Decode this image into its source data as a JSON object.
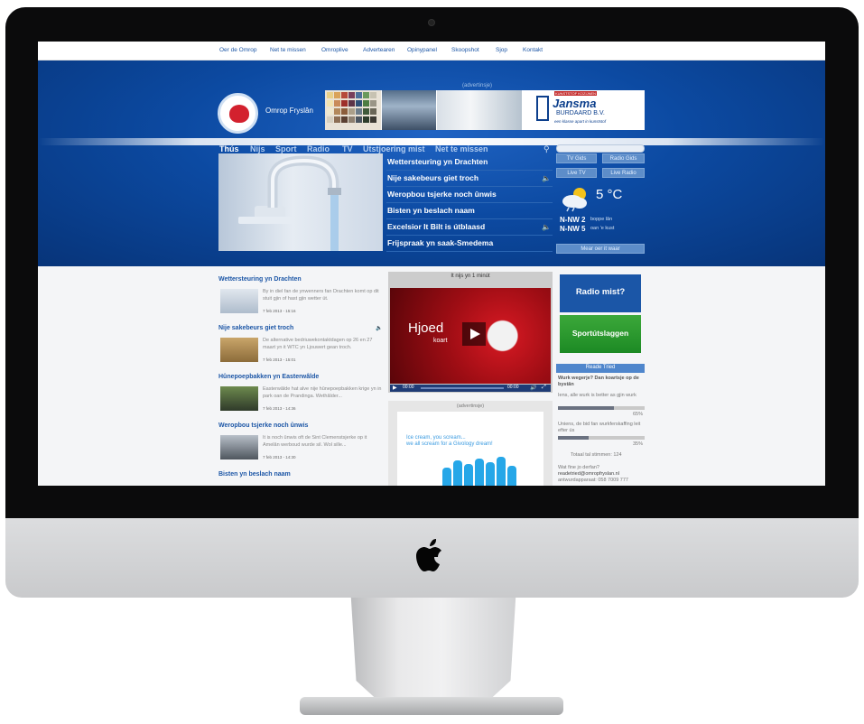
{
  "top_nav": [
    "Oer de Omrop",
    "Net te missen",
    "Omroplive",
    "Advertearen",
    "Opinypanel",
    "Skoopshot",
    "Sjop",
    "Kontakt"
  ],
  "brand": {
    "name": "Omrop Fryslân",
    "ad_label": "(advertinsje)"
  },
  "banner_ad": {
    "company": "Jansma",
    "company_sub": "BURDAARD B.V.",
    "tagline": "een klasse apart in kunststof",
    "badge": "KUNSTSTOF KOZIJNEN"
  },
  "main_nav": [
    "Thús",
    "Nijs",
    "Sport",
    "Radio",
    "TV",
    "Utstjoering mist",
    "Net te missen"
  ],
  "headlines": [
    {
      "title": "Wettersteuring yn Drachten",
      "audio": false
    },
    {
      "title": "Nije sakebeurs giet troch",
      "audio": true
    },
    {
      "title": "Weropbou tsjerke noch ûnwis",
      "audio": false
    },
    {
      "title": "Bisten yn beslach naam",
      "audio": false
    },
    {
      "title": "Excelsior It Bilt is útblaasd",
      "audio": true
    },
    {
      "title": "Frijspraak yn saak-Smedema",
      "audio": false
    }
  ],
  "side_buttons": {
    "tv_gids": "TV Gids",
    "radio_gids": "Radio Gids",
    "live_tv": "Live TV",
    "live_radio": "Live Radio"
  },
  "weather": {
    "temp": "5 °C",
    "wind1": "N-NW 2",
    "wind1_desc": "boppe lân",
    "wind2": "N-NW 5",
    "wind2_desc": "oan 'e kust",
    "more": "Mear oer it waar"
  },
  "news": [
    {
      "title": "Wettersteuring yn Drachten",
      "text": "By in diel fan de ynwenners fan Drachten komt op dit stuit gjin of hast gjin wetter út.",
      "date": "7 feb 2013 - 15:16",
      "audio": false
    },
    {
      "title": "Nije sakebeurs giet troch",
      "text": "De alternative bedriuwekontaktdagen op 26 en 27 maart yn it WTC yn Ljouwert gean troch.",
      "date": "7 feb 2013 - 15:01",
      "audio": true
    },
    {
      "title": "Hûnepoepbakken yn Easterwâlde",
      "text": "Easterwâlde hat alve nije hûnepoepbakken krige yn in park oan de Prandinga. Wethâlder...",
      "date": "7 feb 2013 - 14:36",
      "audio": false
    },
    {
      "title": "Weropbou tsjerke noch ûnwis",
      "text": "It is noch ûnwis oft de Sint Clemenstsjerke op it Amelân werboud wurde sil. Wol sille...",
      "date": "7 feb 2013 - 14:30",
      "audio": false
    },
    {
      "title": "Bisten yn beslach naam",
      "text": "",
      "date": "",
      "audio": false
    }
  ],
  "video": {
    "title": "It nijs yn 1 minút",
    "overlay": "Hjoed",
    "overlay_sub": "koart",
    "time_current": "00:00",
    "time_total": "00:00"
  },
  "ad2": {
    "label": "(advertinsje)",
    "line1": "Ice cream, you scream...",
    "line2": "we all scream for a Givology dream!"
  },
  "promo": {
    "radio_mist": "Radio mist?",
    "sport": "Sportútslaggen"
  },
  "poll": {
    "header": "Reade Tried",
    "question": "Wurk wegerje? Dan koartsje op de bystân",
    "options": [
      {
        "label": "Iens, alle wurk is better as gjin wurk",
        "percent": 65,
        "percent_label": "65%"
      },
      {
        "label": "Uniens, de bid fan wurkferskaffing leit efter ús",
        "percent": 35,
        "percent_label": "35%"
      }
    ],
    "total": "Totaal tal stimmen: 124",
    "contact_q": "Wat fine jo derfan?",
    "email": "readetried@omropfryslan.nl",
    "phone": "antwurdapparaat: 058 7009 777"
  },
  "colors": {
    "brand_blue": "#0c4aa2",
    "link_blue": "#1c56a6",
    "logo_red": "#d3212e",
    "sport_green": "#2b9a30"
  }
}
